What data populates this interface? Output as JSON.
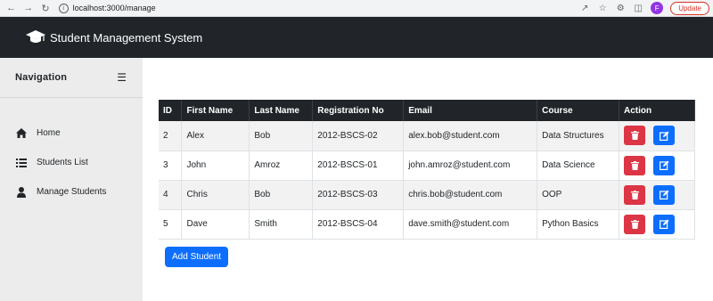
{
  "browser": {
    "url": "localhost:3000/manage",
    "profile_initial": "F",
    "update_label": "Update"
  },
  "header": {
    "title": "Student Management System"
  },
  "sidebar": {
    "title": "Navigation",
    "items": [
      {
        "label": "Home",
        "icon": "home-icon"
      },
      {
        "label": "Students List",
        "icon": "list-icon"
      },
      {
        "label": "Manage Students",
        "icon": "user-icon"
      }
    ]
  },
  "table": {
    "headers": [
      "ID",
      "First Name",
      "Last Name",
      "Registration No",
      "Email",
      "Course",
      "Action"
    ],
    "rows": [
      [
        "2",
        "Alex",
        "Bob",
        "2012-BSCS-02",
        "alex.bob@student.com",
        "Data Structures"
      ],
      [
        "3",
        "John",
        "Amroz",
        "2012-BSCS-01",
        "john.amroz@student.com",
        "Data Science"
      ],
      [
        "4",
        "Chris",
        "Bob",
        "2012-BSCS-03",
        "chris.bob@student.com",
        "OOP"
      ],
      [
        "5",
        "Dave",
        "Smith",
        "2012-BSCS-04",
        "dave.smith@student.com",
        "Python Basics"
      ]
    ]
  },
  "actions": {
    "add_label": "Add Student"
  },
  "colors": {
    "header_bg": "#212529",
    "danger": "#dc3545",
    "primary": "#0d6efd"
  }
}
